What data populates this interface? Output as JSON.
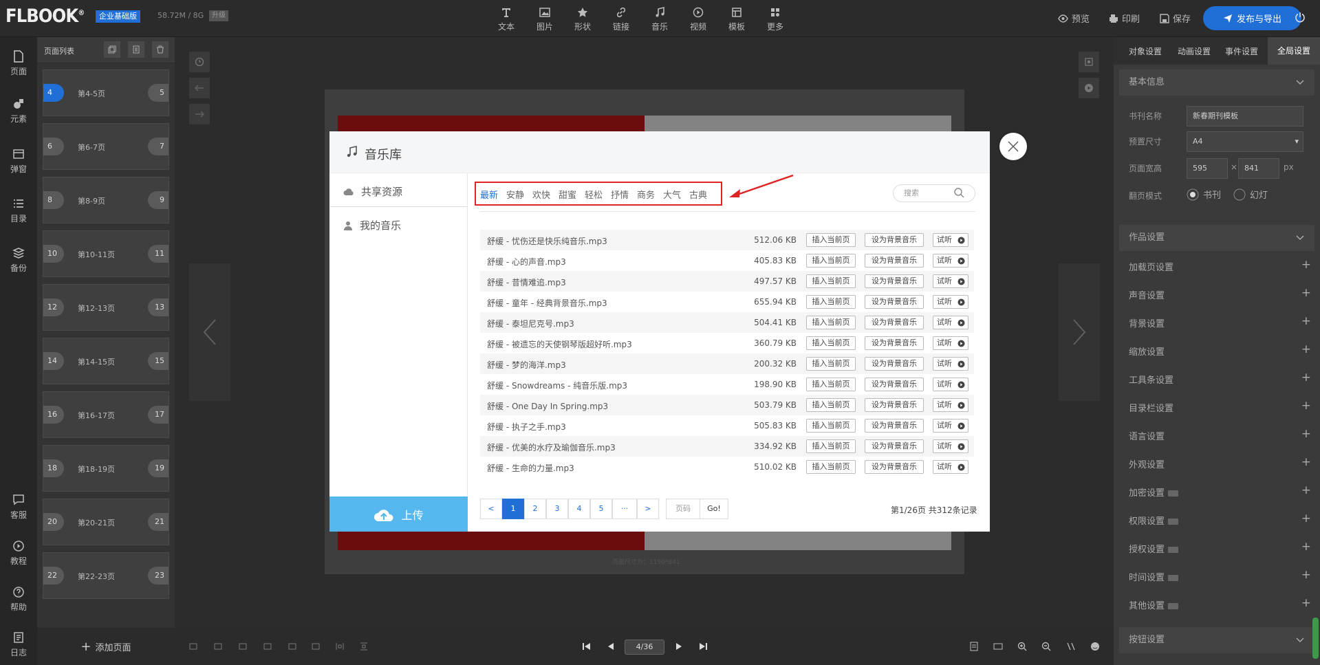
{
  "app": {
    "logo": "FLBOOK",
    "edition": "企业基础版",
    "storage": "58.72M / 8G",
    "upgrade": "升级"
  },
  "toolbar": [
    {
      "label": "文本",
      "icon": "text-icon"
    },
    {
      "label": "图片",
      "icon": "image-icon"
    },
    {
      "label": "形状",
      "icon": "star-icon"
    },
    {
      "label": "链接",
      "icon": "link-icon"
    },
    {
      "label": "音乐",
      "icon": "music-icon"
    },
    {
      "label": "视频",
      "icon": "video-icon"
    },
    {
      "label": "模板",
      "icon": "template-icon"
    },
    {
      "label": "更多",
      "icon": "more-icon"
    }
  ],
  "top_right": {
    "preview": "预览",
    "print": "印刷",
    "save": "保存",
    "publish": "发布与导出"
  },
  "rail": [
    {
      "label": "页面",
      "icon": "page-icon"
    },
    {
      "label": "元素",
      "icon": "elements-icon"
    },
    {
      "label": "弹窗",
      "icon": "popup-icon"
    },
    {
      "label": "目录",
      "icon": "toc-icon"
    },
    {
      "label": "备份",
      "icon": "backup-icon"
    },
    {
      "label": "客服",
      "icon": "service-icon"
    },
    {
      "label": "教程",
      "icon": "tutorial-icon"
    },
    {
      "label": "帮助",
      "icon": "help-icon"
    },
    {
      "label": "日志",
      "icon": "log-icon"
    }
  ],
  "page_panel": {
    "title": "页面列表",
    "add_page": "添加页面",
    "pages": [
      {
        "left": "4",
        "label": "第4-5页",
        "right": "5",
        "active": true
      },
      {
        "left": "6",
        "label": "第6-7页",
        "right": "7"
      },
      {
        "left": "8",
        "label": "第8-9页",
        "right": "9"
      },
      {
        "left": "10",
        "label": "第10-11页",
        "right": "11"
      },
      {
        "left": "12",
        "label": "第12-13页",
        "right": "13"
      },
      {
        "left": "14",
        "label": "第14-15页",
        "right": "15"
      },
      {
        "left": "16",
        "label": "第16-17页",
        "right": "17"
      },
      {
        "left": "18",
        "label": "第18-19页",
        "right": "19"
      },
      {
        "left": "20",
        "label": "第20-21页",
        "right": "21"
      },
      {
        "left": "22",
        "label": "第22-23页",
        "right": "23"
      }
    ]
  },
  "canvas": {
    "size_hint": "页面尺寸为：1190*841"
  },
  "bottombar": {
    "page_indicator": "4/36"
  },
  "right_panel": {
    "tabs": [
      "对象设置",
      "动画设置",
      "事件设置",
      "全局设置"
    ],
    "active_tab": "全局设置",
    "basic_info": {
      "title": "基本信息",
      "book_name_label": "书刊名称",
      "book_name_value": "新春期刊模板",
      "preset_label": "预置尺寸",
      "preset_value": "A4",
      "size_label": "页面宽高",
      "width": "595",
      "times": "×",
      "height": "841",
      "unit": "px",
      "flip_label": "翻页模式",
      "flip_opt1": "书刊",
      "flip_opt2": "幻灯"
    },
    "work_settings_title": "作品设置",
    "settings": [
      {
        "label": "加载页设置",
        "vip": false
      },
      {
        "label": "声音设置",
        "vip": false
      },
      {
        "label": "背景设置",
        "vip": false
      },
      {
        "label": "缩放设置",
        "vip": false
      },
      {
        "label": "工具条设置",
        "vip": false
      },
      {
        "label": "目录栏设置",
        "vip": false
      },
      {
        "label": "语言设置",
        "vip": false
      },
      {
        "label": "外观设置",
        "vip": false
      },
      {
        "label": "加密设置",
        "vip": true
      },
      {
        "label": "权限设置",
        "vip": true
      },
      {
        "label": "授权设置",
        "vip": true
      },
      {
        "label": "时间设置",
        "vip": true
      },
      {
        "label": "其他设置",
        "vip": true
      }
    ],
    "button_settings_title": "按钮设置"
  },
  "modal": {
    "title": "音乐库",
    "sidebar": [
      "共享资源",
      "我的音乐"
    ],
    "upload": "上传",
    "categories": [
      "最新",
      "安静",
      "欢快",
      "甜蜜",
      "轻松",
      "抒情",
      "商务",
      "大气",
      "古典"
    ],
    "active_category": "最新",
    "search_placeholder": "搜索",
    "actions": {
      "insert": "插入当前页",
      "set_bg": "设为背景音乐",
      "listen": "试听"
    },
    "tracks": [
      {
        "name": "舒缓 - 忧伤还是快乐纯音乐.mp3",
        "size": "512.06 KB"
      },
      {
        "name": "舒缓 - 心的声音.mp3",
        "size": "405.83 KB"
      },
      {
        "name": "舒缓 - 昔情难追.mp3",
        "size": "497.57 KB"
      },
      {
        "name": "舒缓 - 童年 - 经典背景音乐.mp3",
        "size": "655.94 KB"
      },
      {
        "name": "舒缓 - 泰坦尼克号.mp3",
        "size": "504.41 KB"
      },
      {
        "name": "舒缓 - 被遗忘的天使钢琴版超好听.mp3",
        "size": "360.79 KB"
      },
      {
        "name": "舒缓 - 梦的海洋.mp3",
        "size": "200.32 KB"
      },
      {
        "name": "舒缓 - Snowdreams - 纯音乐版.mp3",
        "size": "198.90 KB"
      },
      {
        "name": "舒缓 - One Day In Spring.mp3",
        "size": "503.79 KB"
      },
      {
        "name": "舒缓 - 执子之手.mp3",
        "size": "505.83 KB"
      },
      {
        "name": "舒缓 - 优美的水疗及瑜伽音乐.mp3",
        "size": "334.92 KB"
      },
      {
        "name": "舒缓 - 生命的力量.mp3",
        "size": "510.02 KB"
      }
    ],
    "pagination": {
      "prev": "<",
      "pages": [
        "1",
        "2",
        "3",
        "4",
        "5"
      ],
      "ellipsis": "···",
      "next": ">",
      "page_input_placeholder": "页码",
      "go": "Go!",
      "info": "第1/26页  共312条记录"
    }
  },
  "colors": {
    "accent": "#1f6fd6",
    "upload": "#55b7ee",
    "highlight": "#e02424"
  }
}
